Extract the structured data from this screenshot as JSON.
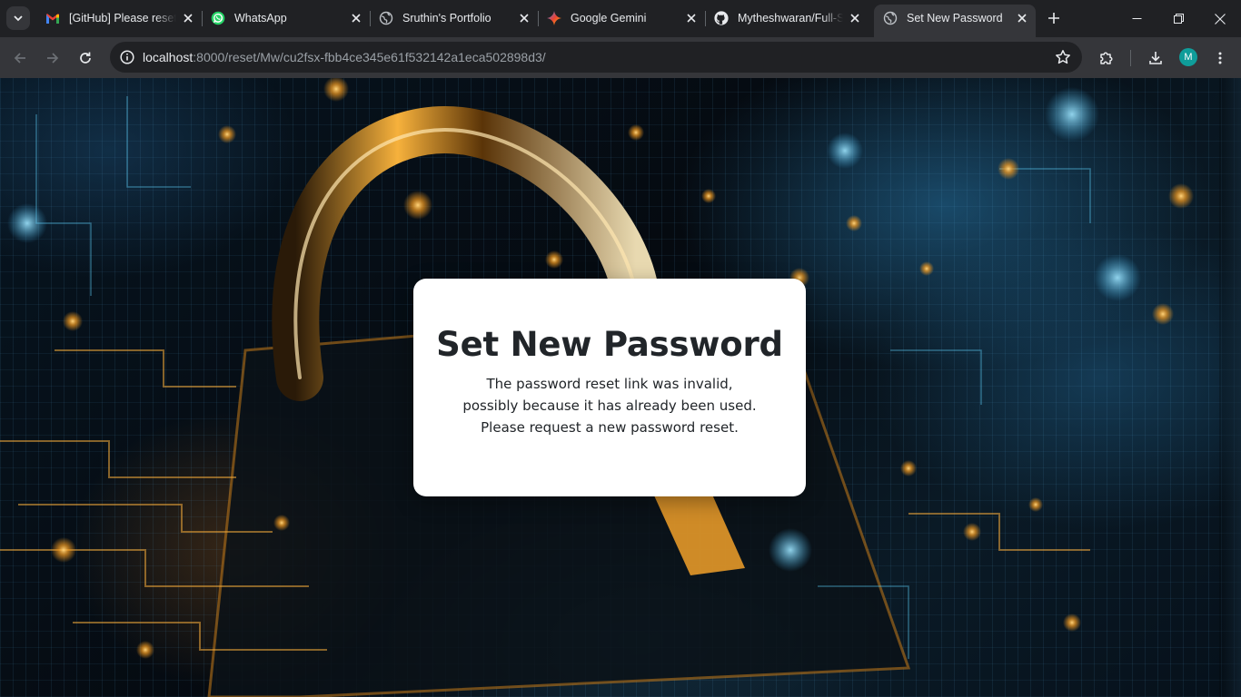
{
  "browser": {
    "tabs": [
      {
        "title": "[GitHub] Please reset",
        "icon": "gmail-icon"
      },
      {
        "title": "WhatsApp",
        "icon": "whatsapp-icon"
      },
      {
        "title": "Sruthin's Portfolio",
        "icon": "globe-icon"
      },
      {
        "title": "Google Gemini",
        "icon": "gemini-icon"
      },
      {
        "title": "Mytheshwaran/Full-S",
        "icon": "github-icon"
      },
      {
        "title": "Set New Password",
        "icon": "globe-icon",
        "active": true
      }
    ],
    "address_bar": {
      "host": "localhost",
      "path": ":8000/reset/Mw/cu2fsx-fbb4ce345e61f532142a1eca502898d3/"
    },
    "profile_initial": "M"
  },
  "page": {
    "title": "Set New Password",
    "message": "The password reset link was invalid, possibly because it has already been used. Please request a new password reset."
  },
  "colors": {
    "card_background": "#ffffff",
    "text": "#212529",
    "avatar": "#0f9d9a",
    "lock_glow": "#f5a623"
  }
}
